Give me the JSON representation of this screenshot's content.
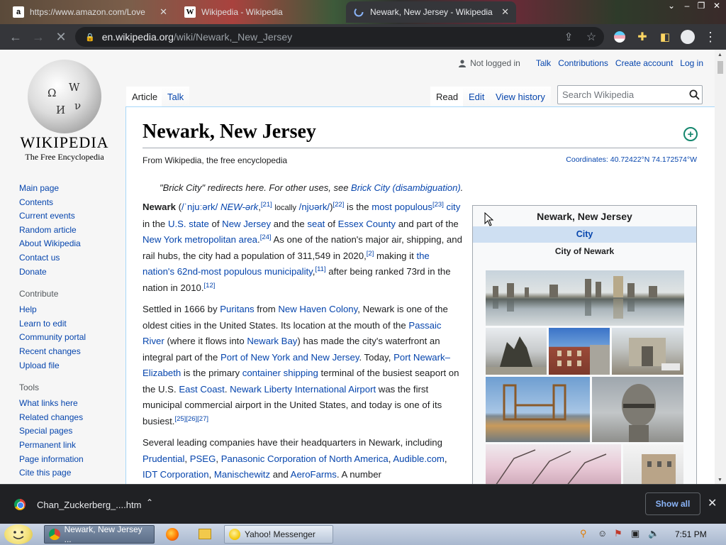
{
  "browser": {
    "tabs": [
      {
        "title": "https://www.amazon.com/Love",
        "favicon": "a",
        "active": false
      },
      {
        "title": "Wikipedia - Wikipedia",
        "favicon": "W",
        "active": false
      },
      {
        "title": "Newark, New Jersey - Wikipedia",
        "favicon": "loading",
        "active": true
      }
    ],
    "url_host": "en.wikipedia.org",
    "url_path": "/wiki/Newark,_New_Jersey"
  },
  "wiki": {
    "logo": {
      "wordmark": "WIKIPEDIA",
      "tagline": "The Free Encyclopedia"
    },
    "personal": {
      "not_logged_in": "Not logged in",
      "talk": "Talk",
      "contributions": "Contributions",
      "create_account": "Create account",
      "log_in": "Log in"
    },
    "page_tabs": {
      "article": "Article",
      "talk": "Talk",
      "read": "Read",
      "edit": "Edit",
      "view_history": "View history"
    },
    "search_placeholder": "Search Wikipedia",
    "navigation": [
      "Main page",
      "Contents",
      "Current events",
      "Random article",
      "About Wikipedia",
      "Contact us",
      "Donate"
    ],
    "contribute_heading": "Contribute",
    "contribute": [
      "Help",
      "Learn to edit",
      "Community portal",
      "Recent changes",
      "Upload file"
    ],
    "tools_heading": "Tools",
    "tools": [
      "What links here",
      "Related changes",
      "Special pages",
      "Permanent link",
      "Page information",
      "Cite this page"
    ],
    "title": "Newark, New Jersey",
    "from_wiki": "From Wikipedia, the free encyclopedia",
    "coordinates_label": "Coordinates: ",
    "coordinates_value": "40.72422°N 74.172574°W",
    "hatnote_text": "\"Brick City\" redirects here. For other uses, see ",
    "hatnote_link": "Brick City (disambiguation)",
    "infobox": {
      "title": "Newark, New Jersey",
      "type": "City",
      "subtitle": "City of Newark"
    }
  },
  "downloads": {
    "filename": "Chan_Zuckerberg_....htm",
    "show_all": "Show all"
  },
  "taskbar": {
    "tasks": [
      {
        "label": "Newark, New Jersey ...",
        "active": true
      },
      {
        "label": "Yahoo! Messenger",
        "active": false
      }
    ],
    "clock": "7:51 PM"
  },
  "colors": {
    "link": "#0645ad",
    "infobox_header": "#cedff2",
    "chrome_dark": "#35363a"
  }
}
